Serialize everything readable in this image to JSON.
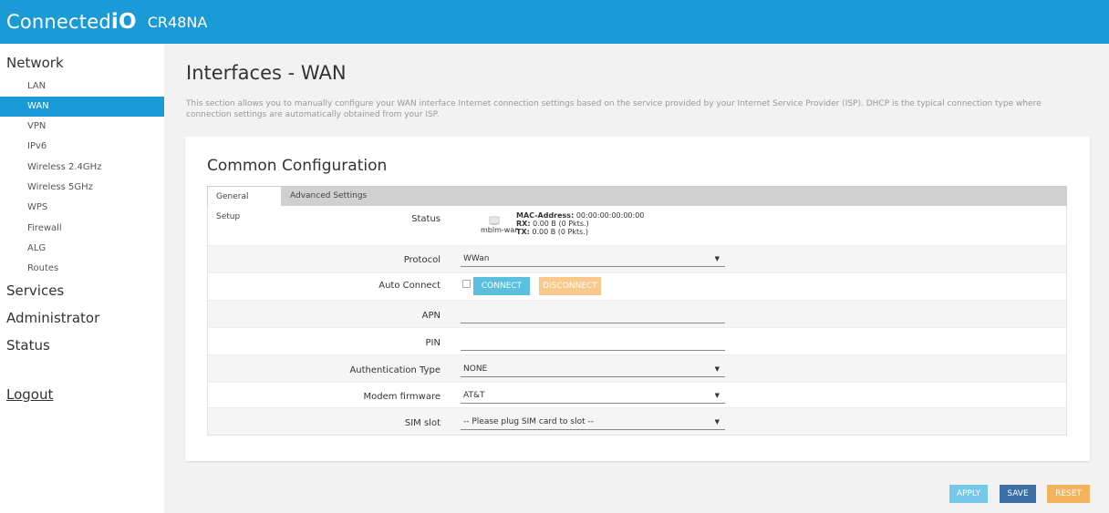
{
  "header": {
    "brand_light": "Connected",
    "brand_bold": "iO",
    "model": "CR48NA"
  },
  "sidebar": {
    "network_label": "Network",
    "network_items": [
      {
        "label": "LAN"
      },
      {
        "label": "WAN",
        "active": true
      },
      {
        "label": "VPN"
      },
      {
        "label": "IPv6"
      },
      {
        "label": "Wireless 2.4GHz"
      },
      {
        "label": "Wireless 5GHz"
      },
      {
        "label": "WPS"
      },
      {
        "label": "Firewall"
      },
      {
        "label": "ALG"
      },
      {
        "label": "Routes"
      }
    ],
    "services_label": "Services",
    "administrator_label": "Administrator",
    "status_label": "Status",
    "logout_label": "Logout"
  },
  "main": {
    "title": "Interfaces - WAN",
    "description": "This section allows you to manually configure your WAN interface Internet connection settings based on the service provided by your Internet Service Provider (ISP). DHCP is the typical connection type where connection settings are automatically obtained from your ISP.",
    "card_title": "Common Configuration",
    "tabs": [
      {
        "label": "General Setup",
        "active": true
      },
      {
        "label": "Advanced Settings"
      }
    ]
  },
  "form": {
    "status": {
      "label": "Status",
      "ifname": "mblm-wan",
      "mac_label": "MAC-Address:",
      "mac_value": "00:00:00:00:00:00",
      "rx_label": "RX:",
      "rx_value": "0.00 B (0 Pkts.)",
      "tx_label": "TX:",
      "tx_value": "0.00 B (0 Pkts.)"
    },
    "protocol": {
      "label": "Protocol",
      "value": "WWan"
    },
    "auto_connect": {
      "label": "Auto Connect",
      "connect_label": "CONNECT",
      "disconnect_label": "DISCONNECT"
    },
    "apn": {
      "label": "APN",
      "value": ""
    },
    "pin": {
      "label": "PIN",
      "value": ""
    },
    "auth_type": {
      "label": "Authentication Type",
      "value": "NONE"
    },
    "modem_firmware": {
      "label": "Modem firmware",
      "value": "AT&T"
    },
    "sim_slot": {
      "label": "SIM slot",
      "value": "-- Please plug SIM card to slot --"
    }
  },
  "footer": {
    "apply_label": "APPLY",
    "save_label": "SAVE",
    "reset_label": "RESET"
  },
  "colors": {
    "accent": "#1a9bd7",
    "connect": "#5bc0de",
    "disconnect": "#f8c98a",
    "save": "#3a6ea5",
    "reset": "#f3b25c"
  },
  "icons": {
    "status_icon": "network-interface-icon",
    "dropdown_icon": "caret-down-icon"
  }
}
